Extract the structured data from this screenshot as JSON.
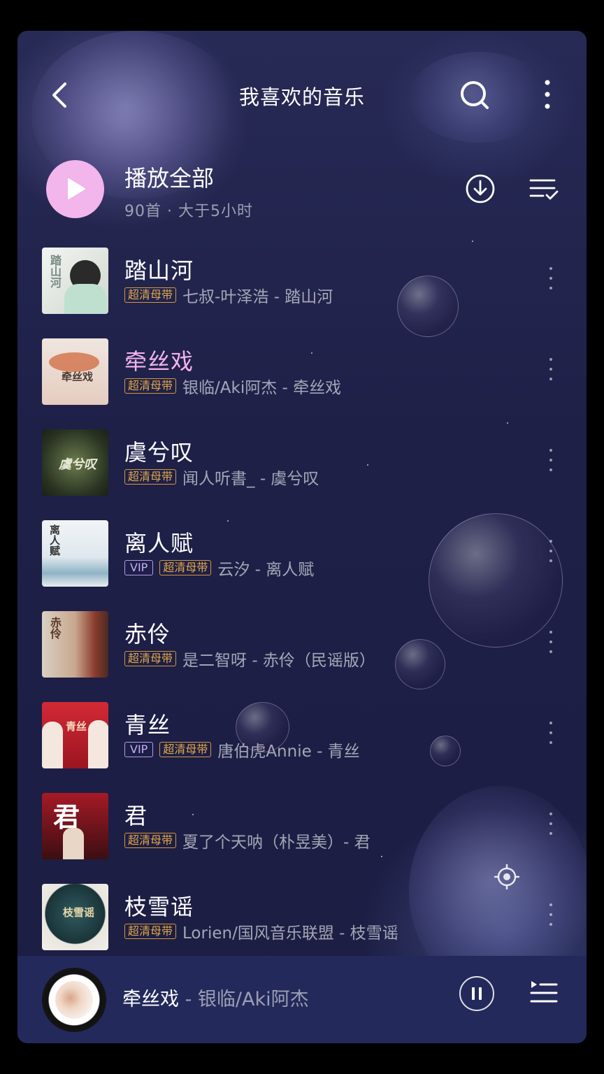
{
  "header": {
    "title": "我喜欢的音乐",
    "back_icon": "chevron-left-icon",
    "search_icon": "search-icon",
    "more_icon": "more-vertical-icon"
  },
  "play_all": {
    "label": "播放全部",
    "meta": "90首 · 大于5小时",
    "button_color": "#f2b5ec",
    "download_icon": "download-icon",
    "multi_select_icon": "multi-select-icon"
  },
  "colors": {
    "accent_pink": "#f2b5ec",
    "hq_badge": "#e4a847",
    "vip_badge": "#c8aef5",
    "player_bg": "#23295a"
  },
  "songs": [
    {
      "title": "踏山河",
      "active": false,
      "badges": [
        "超清母带"
      ],
      "artist_album": "七叔-叶泽浩 - 踏山河",
      "cover_text": "踏山河"
    },
    {
      "title": "牵丝戏",
      "active": true,
      "badges": [
        "超清母带"
      ],
      "artist_album": "银临/Aki阿杰 - 牵丝戏",
      "cover_text": "牵丝戏"
    },
    {
      "title": "虞兮叹",
      "active": false,
      "badges": [
        "超清母带"
      ],
      "artist_album": "闻人听書_ - 虞兮叹",
      "cover_text": "虞兮叹"
    },
    {
      "title": "离人赋",
      "active": false,
      "badges": [
        "VIP",
        "超清母带"
      ],
      "artist_album": "云汐 - 离人赋",
      "cover_text": "离人赋"
    },
    {
      "title": "赤伶",
      "active": false,
      "badges": [
        "超清母带"
      ],
      "artist_album": "是二智呀 - 赤伶（民谣版）",
      "cover_text": "赤伶"
    },
    {
      "title": "青丝",
      "active": false,
      "badges": [
        "VIP",
        "超清母带"
      ],
      "artist_album": "唐伯虎Annie - 青丝",
      "cover_text": "青丝"
    },
    {
      "title": "君",
      "active": false,
      "badges": [
        "超清母带"
      ],
      "artist_album": "夏了个天呐（朴昱美）- 君",
      "cover_text": "君"
    },
    {
      "title": "枝雪谣",
      "active": false,
      "badges": [
        "超清母带"
      ],
      "artist_album": "Lorien/国风音乐联盟 - 枝雪谣",
      "cover_text": "枝雪谣"
    }
  ],
  "now_playing": {
    "title": "牵丝戏",
    "separator": " - ",
    "artist": "银临/Aki阿杰",
    "pause_icon": "pause-icon",
    "playlist_icon": "playlist-icon"
  },
  "locate_icon": "locate-icon"
}
